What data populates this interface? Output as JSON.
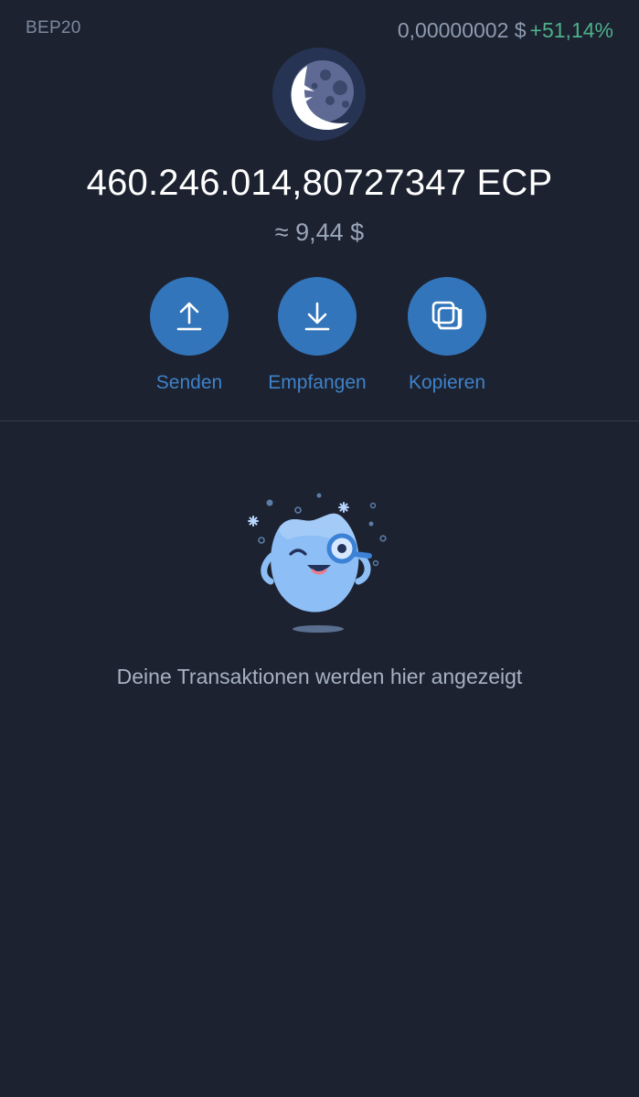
{
  "header": {
    "network": "BEP20",
    "price": "0,00000002 $",
    "change": "+51,14%"
  },
  "token": {
    "logo_icon": "crescent-moon-logo-icon",
    "balance": "460.246.014,80727347 ECP",
    "fiat_value": "≈ 9,44 $"
  },
  "actions": [
    {
      "label": "Senden",
      "icon": "upload-arrow-icon"
    },
    {
      "label": "Empfangen",
      "icon": "download-arrow-icon"
    },
    {
      "label": "Kopieren",
      "icon": "copy-icon"
    }
  ],
  "transactions": {
    "empty_message": "Deine Transaktionen werden hier angezeigt",
    "illustration_icon": "magnifier-mascot-icon"
  },
  "colors": {
    "background": "#1c2230",
    "accent": "#3375bb",
    "positive": "#4fb08a"
  }
}
